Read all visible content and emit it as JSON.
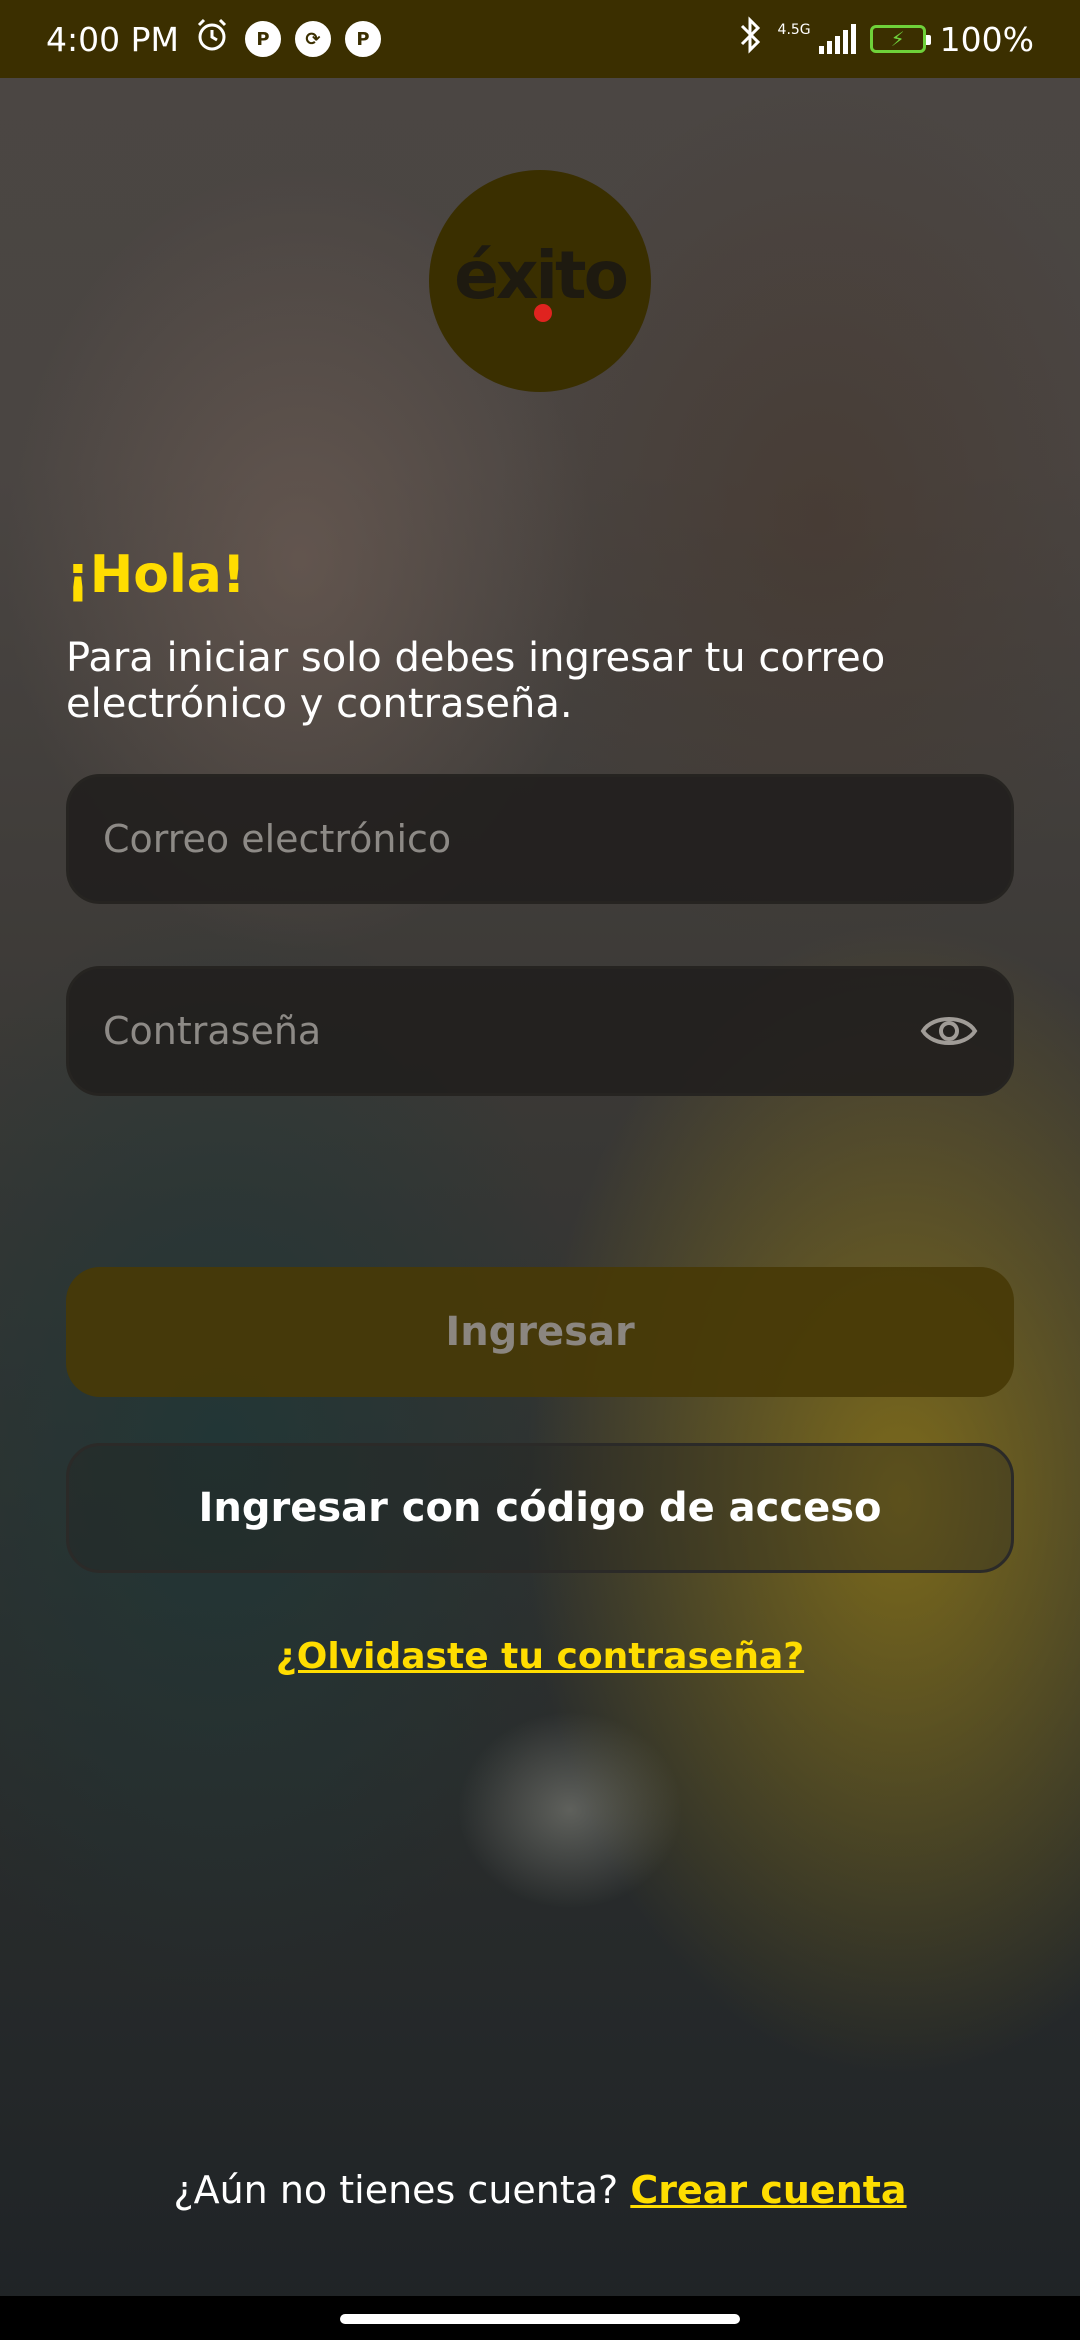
{
  "status_bar": {
    "time": "4:00 PM",
    "network_type": "4.5G",
    "battery_percent": "100%"
  },
  "logo": {
    "text": "éxito",
    "name": "exito-logo"
  },
  "login": {
    "greeting": "¡Hola!",
    "intro": "Para iniciar solo debes ingresar tu correo electrónico y contraseña.",
    "email_placeholder": "Correo electrónico",
    "email_value": "",
    "password_placeholder": "Contraseña",
    "password_value": "",
    "login_button_label": "Ingresar",
    "code_button_label": "Ingresar con código de acceso",
    "forgot_password_label": "¿Olvidaste tu contraseña?",
    "signup_prompt": "¿Aún no tienes cuenta?",
    "signup_link_label": "Crear cuenta"
  },
  "colors": {
    "accent": "#ffdd00",
    "status_bar_bg": "#3b2f00",
    "logo_dot": "#e0231f"
  },
  "icons": [
    "alarm-icon",
    "app-notification-icon",
    "sync-icon",
    "bluetooth-icon",
    "signal-icon",
    "battery-charging-icon",
    "eye-icon"
  ]
}
